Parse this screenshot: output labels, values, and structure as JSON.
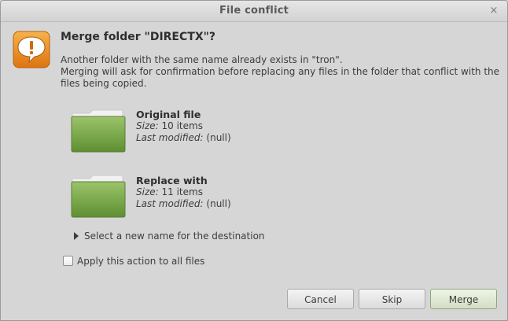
{
  "window": {
    "title": "File conflict",
    "close_glyph": "×"
  },
  "dialog": {
    "icon": "warning-icon",
    "heading": "Merge folder \"DIRECTX\"?",
    "message_line1": "Another folder with the same name already exists in \"tron\".",
    "message_line2": "Merging will ask for confirmation before replacing any files in the folder that conflict with the files being copied."
  },
  "original": {
    "title": "Original file",
    "size_label": "Size:",
    "size_value": " 10 items",
    "modified_label": "Last modified:",
    "modified_value": " (null)"
  },
  "replacement": {
    "title": "Replace with",
    "size_label": "Size:",
    "size_value": " 11 items",
    "modified_label": "Last modified:",
    "modified_value": " (null)"
  },
  "expander_label": "Select a new name for the destination",
  "apply_all": {
    "label": "Apply this action to all files",
    "checked": false
  },
  "buttons": {
    "cancel": "Cancel",
    "skip": "Skip",
    "merge": "Merge"
  },
  "colors": {
    "accent": "#e88a1a",
    "folder_green": "#76a84a"
  }
}
